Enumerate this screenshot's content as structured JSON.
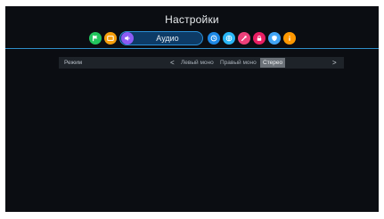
{
  "title": "Настройки",
  "tabs": {
    "active_label": "Аудио",
    "icons": [
      {
        "name": "flag-icon",
        "color": "#22c55e"
      },
      {
        "name": "picture-icon",
        "color": "#f59e0b"
      },
      {
        "name": "speaker-icon",
        "color": "#8b5cf6"
      },
      {
        "name": "clock-icon",
        "color": "#1e88e5"
      },
      {
        "name": "globe-icon",
        "color": "#29b6f6"
      },
      {
        "name": "wrench-icon",
        "color": "#ec407a"
      },
      {
        "name": "lock-icon",
        "color": "#e91e63"
      },
      {
        "name": "shield-icon",
        "color": "#42a5f5"
      },
      {
        "name": "info-icon",
        "color": "#ff9800"
      }
    ]
  },
  "setting": {
    "label": "Режим",
    "options": [
      "Левый моно",
      "Правый моно",
      "Стерео"
    ],
    "selected": "Стерео",
    "prev_arrow": "<",
    "next_arrow": ">"
  },
  "colors": {
    "background": "#0b0d12",
    "accent": "#2f8fc9",
    "row_background": "#1e2329",
    "selected_option": "#6b7178"
  }
}
